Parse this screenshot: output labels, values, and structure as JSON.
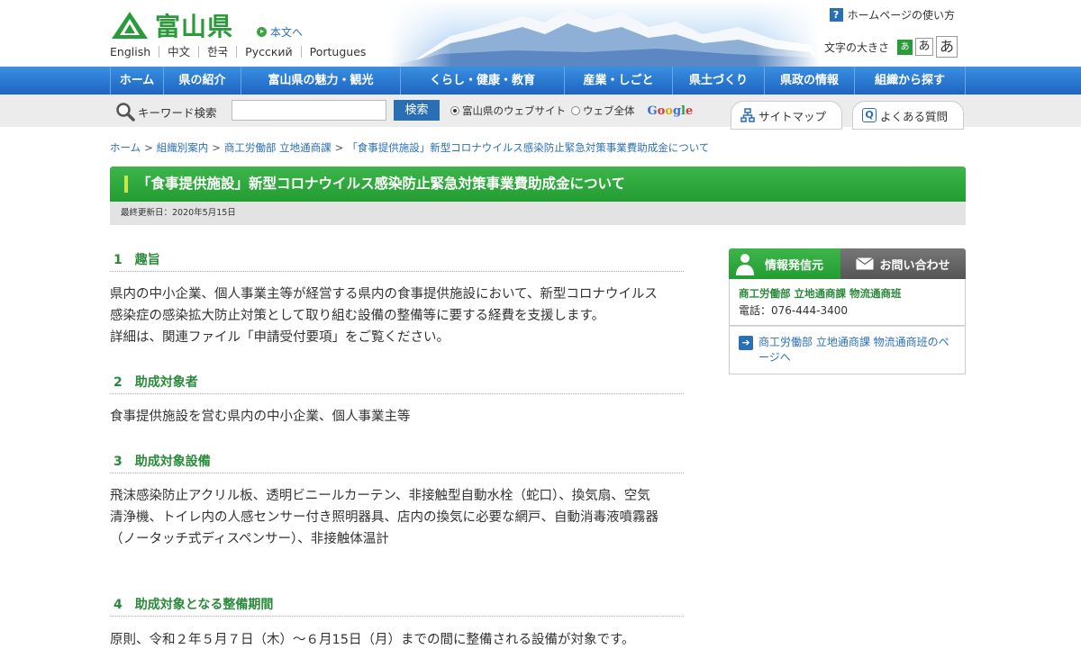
{
  "header": {
    "logo_text": "富山県",
    "skip_link": "本文へ",
    "languages": [
      "English",
      "中文",
      "한국",
      "Русский",
      "Portugues"
    ],
    "howto": "ホームページの使い方",
    "font_size_label": "文字の大きさ",
    "font_size_options": [
      "あ",
      "あ",
      "あ"
    ]
  },
  "nav": {
    "items": [
      "ホーム",
      "県の紹介",
      "富山県の魅力・観光",
      "くらし・健康・教育",
      "産業・しごと",
      "県土づくり",
      "県政の情報",
      "組織から探す"
    ]
  },
  "search": {
    "label": "キーワード検索",
    "placeholder": "",
    "button": "検索",
    "scope_site": "富山県のウェブサイト",
    "scope_web": "ウェブ全体",
    "google": "Google",
    "sitemap": "サイトマップ",
    "faq": "よくある質問"
  },
  "breadcrumb": [
    "ホーム",
    "組織別案内",
    "商工労働部 立地通商課",
    "「食事提供施設」新型コロナウイルス感染防止緊急対策事業費助成金について"
  ],
  "page": {
    "title": "「食事提供施設」新型コロナウイルス感染防止緊急対策事業費助成金について",
    "updated": "最終更新日：2020年5月15日"
  },
  "sections": [
    {
      "num": "1",
      "heading": "趣旨",
      "lines": [
        "県内の中小企業、個人事業主等が経営する県内の食事提供施設において、新型コロナウイルス",
        "感染症の感染拡大防止対策として取り組む設備の整備等に要する経費を支援します。",
        "詳細は、関連ファイル「申請受付要項」をご覧ください。"
      ]
    },
    {
      "num": "2",
      "heading": "助成対象者",
      "lines": [
        "食事提供施設を営む県内の中小企業、個人事業主等"
      ]
    },
    {
      "num": "3",
      "heading": "助成対象設備",
      "lines": [
        "飛沫感染防止アクリル板、透明ビニールカーテン、非接触型自動水栓（蛇口）、換気扇、空気",
        "清浄機、トイレ内の人感センサー付き照明器具、店内の換気に必要な網戸、自動消毒液噴霧器",
        "（ノータッチ式ディスペンサー）、非接触体温計"
      ]
    },
    {
      "num": "4",
      "heading": "助成対象となる整備期間",
      "lines": [
        "原則、令和２年５月７日（木）～６月15日（月）までの間に整備される設備が対象です。"
      ]
    }
  ],
  "sidebar": {
    "tab_info": "情報発信元",
    "tab_contact": "お問い合わせ",
    "dept": "商工労働部 立地通商課 物流通商班",
    "tel": "電話：076-444-3400",
    "link_line1": "商工労働部 立地通商課 物流通商班のペ",
    "link_line2": "ージへ"
  },
  "colors": {
    "green": "#2a9a3a",
    "blue_nav": "#1d65c2",
    "link": "#2a6fb5"
  }
}
